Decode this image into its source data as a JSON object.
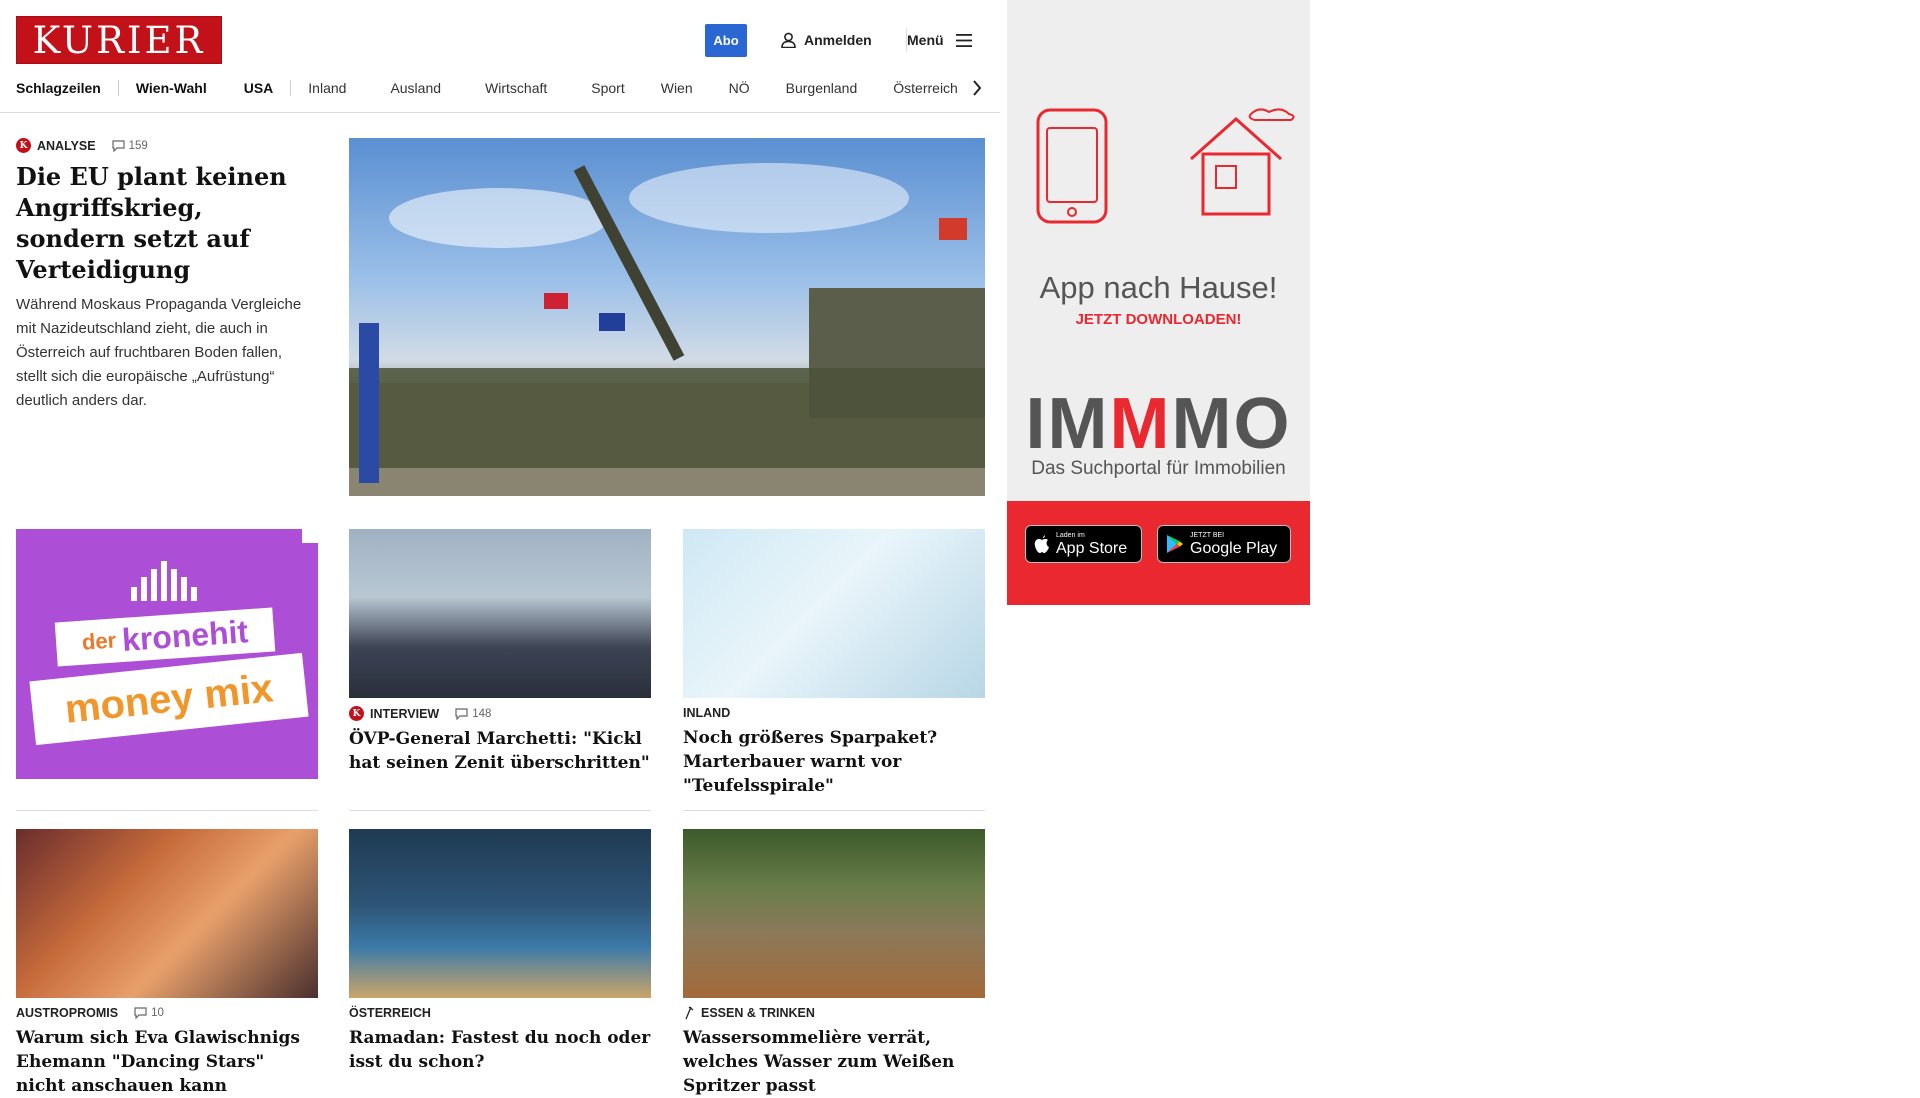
{
  "header": {
    "logo": "KURIER",
    "abo_label": "Abo",
    "login_label": "Anmelden",
    "menu_label": "Menü",
    "accent": "#c3111a",
    "abo_color": "#2a67d3"
  },
  "nav": {
    "items": [
      "Schlagzeilen",
      "Wien-Wahl",
      "USA",
      "Inland",
      "Ausland",
      "Wirtschaft",
      "Sport",
      "Wien",
      "NÖ",
      "Burgenland",
      "Österreich"
    ]
  },
  "lead": {
    "kicker": "ANALYSE",
    "comments": "159",
    "title": "Die EU plant keinen Angriffskrieg, sondern setzt auf Verteidigung",
    "teaser": "Während Moskaus Propaganda Vergleiche mit Nazideutschland zieht, die auch in Österreich auf fruchtbaren Boden fallen, stellt sich die europäische „Aufrüstung“ deutlich anders dar."
  },
  "ad_kronehit": {
    "top": "der",
    "brand": "kronehit",
    "line2": "money mix"
  },
  "articles": [
    {
      "kicker": "INTERVIEW",
      "comments": "148",
      "title": "ÖVP-General Marchetti: \"Kickl hat seinen Zenit überschritten\""
    },
    {
      "kicker": "INLAND",
      "comments": "",
      "title": "Noch größeres Sparpaket? Marterbauer warnt vor \"Teufelsspirale\""
    },
    {
      "kicker": "AUSTROPROMIS",
      "comments": "10",
      "title": "Warum sich Eva Glawischnigs Ehemann \"Dancing Stars\" nicht anschauen kann"
    },
    {
      "kicker": "ÖSTERREICH",
      "comments": "",
      "title": "Ramadan: Fastest du noch oder isst du schon?"
    },
    {
      "kicker": "ESSEN & TRINKEN",
      "comments": "",
      "title": "Wassersommelière verrät, welches Wasser zum Weißen Spritzer passt"
    }
  ],
  "side_ad": {
    "headline": "App nach Hause!",
    "cta": "JETZT DOWNLOADEN!",
    "brand": "IMMMO",
    "tagline": "Das Suchportal für Immobilien",
    "appstore_small": "Laden im",
    "appstore_big": "App Store",
    "googleplay_small": "JETZT BEI",
    "googleplay_big": "Google Play",
    "accent": "#e9282f"
  }
}
